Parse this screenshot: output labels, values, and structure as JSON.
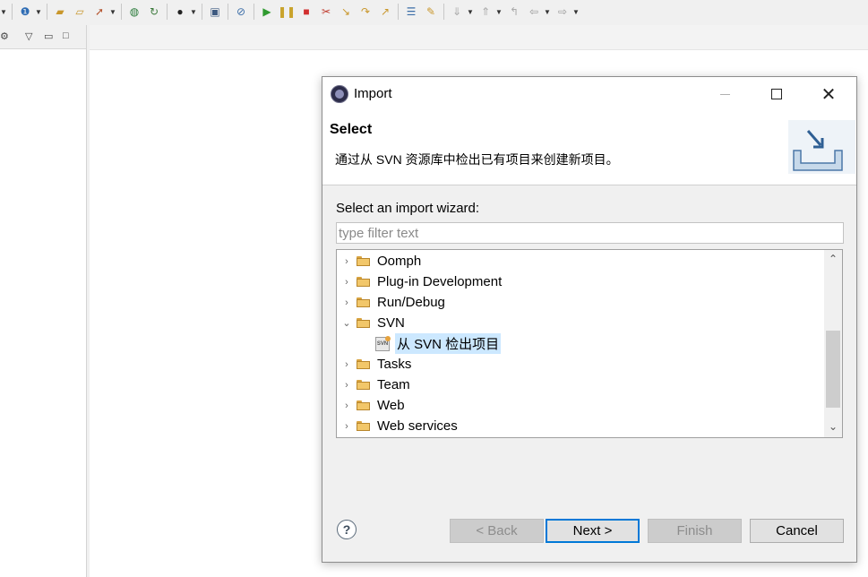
{
  "dialog": {
    "title": "Import",
    "header_title": "Select",
    "header_description": "通过从 SVN 资源库中检出已有项目来创建新项目。",
    "wizard_label": "Select an import wizard:",
    "filter_placeholder": "type filter text",
    "tree": [
      {
        "label": "Oomph",
        "expanded": false
      },
      {
        "label": "Plug-in Development",
        "expanded": false
      },
      {
        "label": "Run/Debug",
        "expanded": false
      },
      {
        "label": "SVN",
        "expanded": true
      },
      {
        "label": "从 SVN 检出项目",
        "child": true,
        "selected": true,
        "icon": "svn-checkout-icon"
      },
      {
        "label": "Tasks",
        "expanded": false
      },
      {
        "label": "Team",
        "expanded": false
      },
      {
        "label": "Web",
        "expanded": false
      },
      {
        "label": "Web services",
        "expanded": false
      }
    ],
    "buttons": {
      "back": "< Back",
      "next": "Next >",
      "finish": "Finish",
      "cancel": "Cancel",
      "help": "?"
    }
  },
  "colors": {
    "selection": "#cce8ff",
    "default_button_border": "#0078d7",
    "folder": "#f2c76a"
  }
}
